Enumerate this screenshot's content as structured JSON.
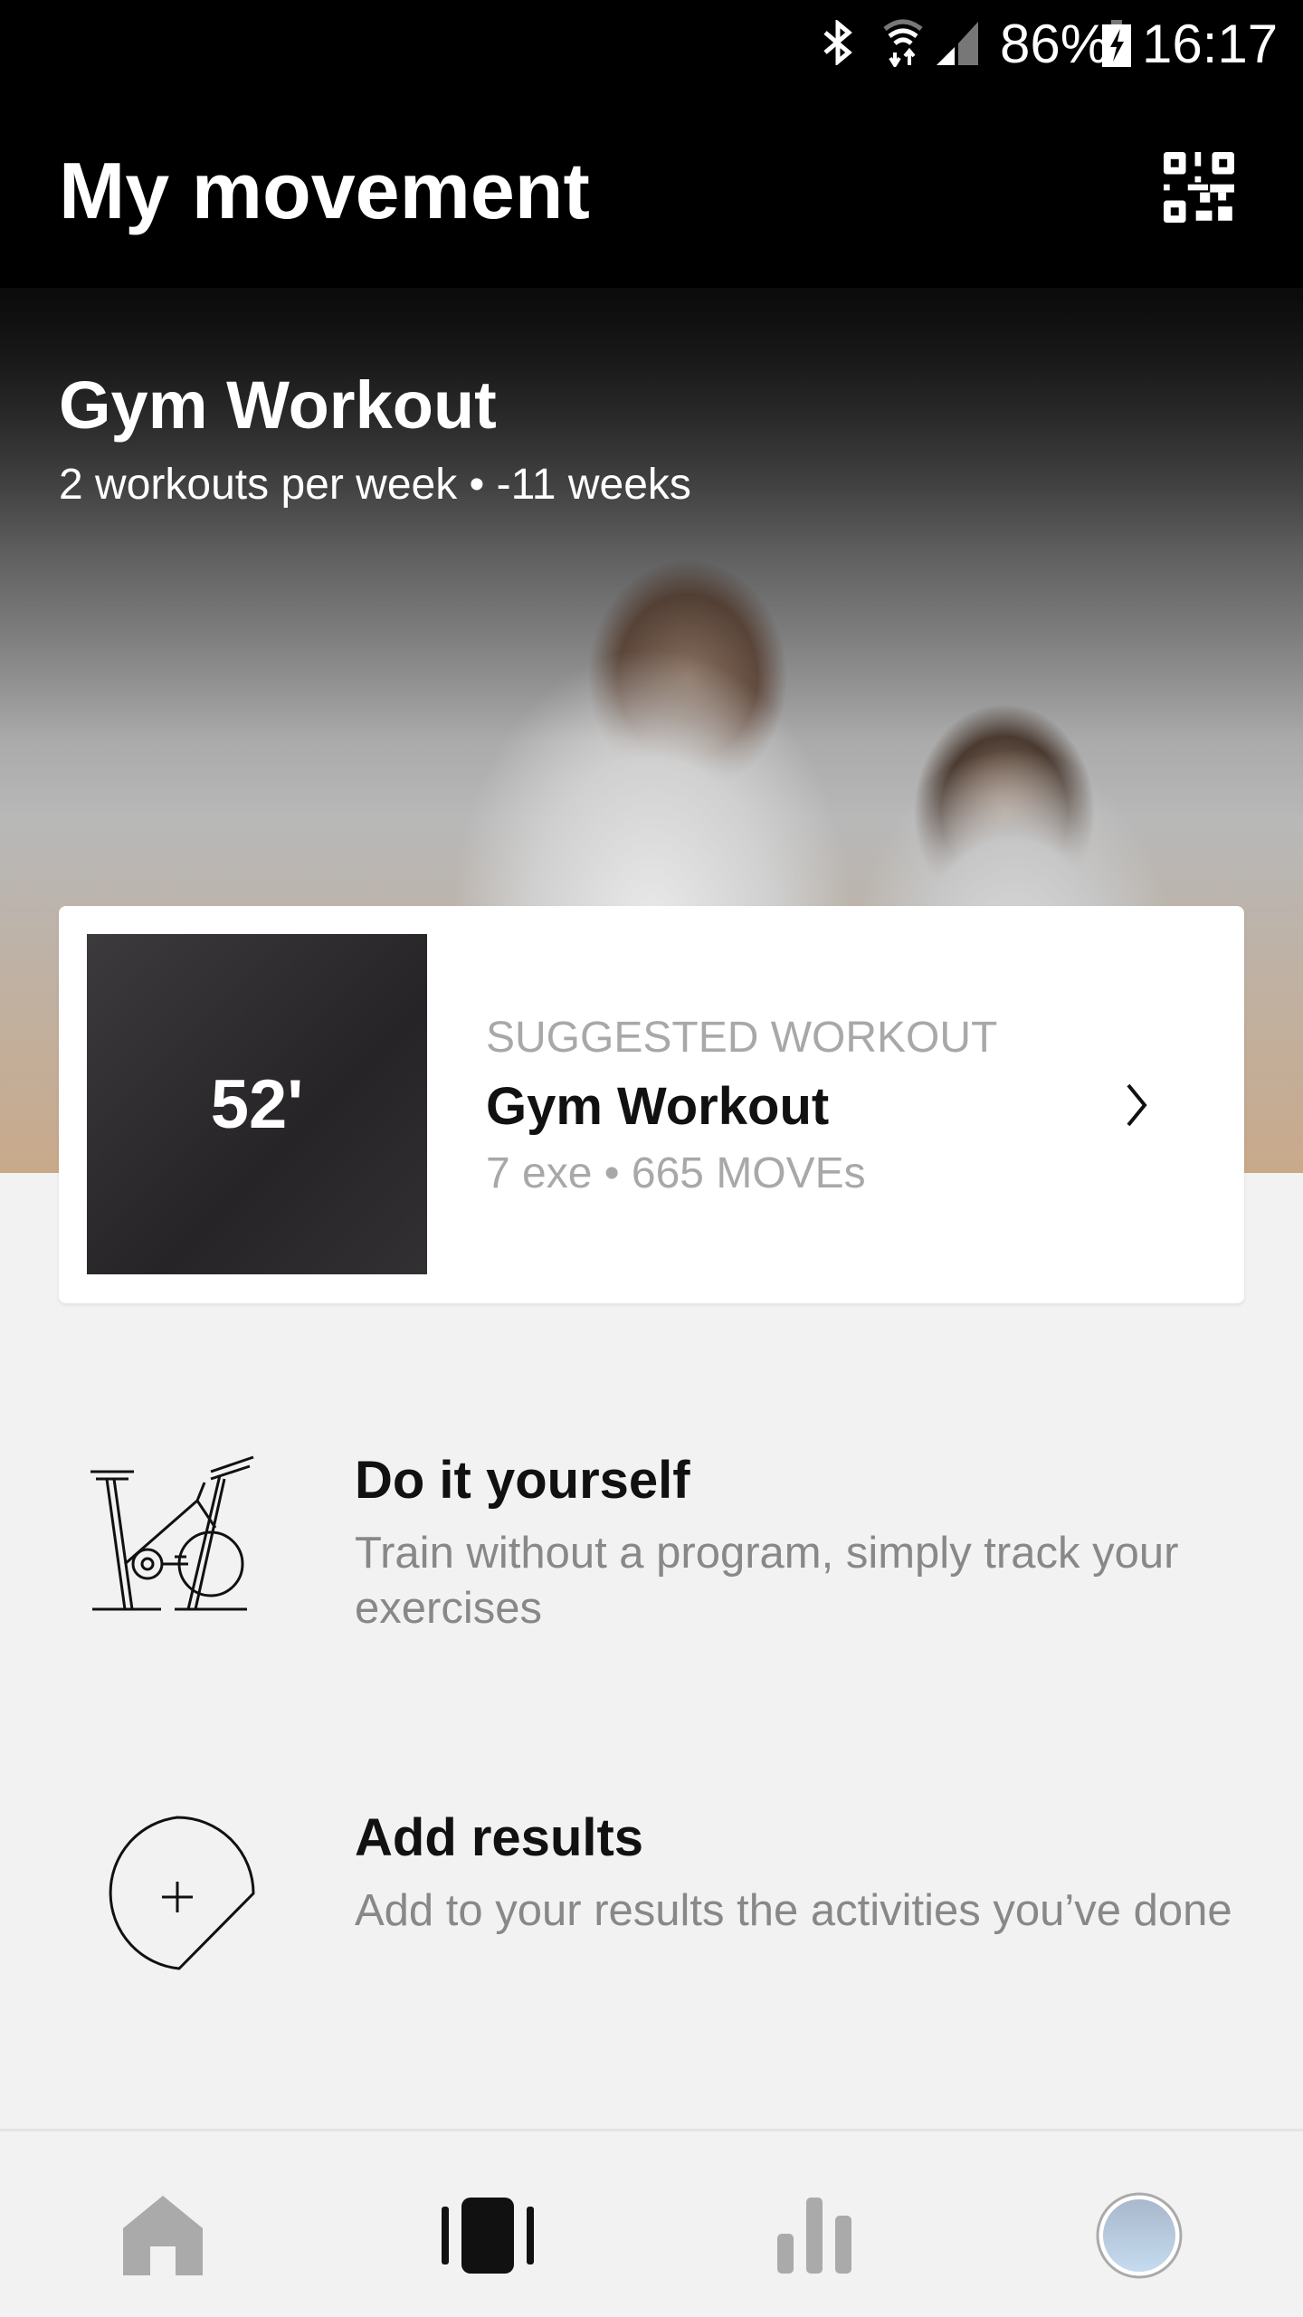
{
  "status_bar": {
    "battery": "86%",
    "time": "16:17",
    "icons": [
      "bluetooth-icon",
      "wifi-icon",
      "signal-icon",
      "battery-charging-icon"
    ]
  },
  "header": {
    "title": "My movement",
    "qr_icon": "qr-code-icon"
  },
  "program": {
    "title": "Gym Workout",
    "subtitle": "2 workouts per week • -11 weeks"
  },
  "suggested": {
    "label": "SUGGESTED WORKOUT",
    "name": "Gym Workout",
    "meta": "7 exe • 665 MOVEs",
    "duration": "52'"
  },
  "options": [
    {
      "title": "Do it yourself",
      "description": "Train without a program, simply track your exercises",
      "icon": "exercise-bike-icon"
    },
    {
      "title": "Add results",
      "description": "Add to your results the activities you’ve done",
      "icon": "add-circle-icon"
    }
  ],
  "nav": {
    "items": [
      "home-icon",
      "workout-icon",
      "stats-icon",
      "profile-avatar"
    ],
    "active": 1,
    "active_color": "#111111",
    "inactive_color": "#aaaaaa"
  }
}
